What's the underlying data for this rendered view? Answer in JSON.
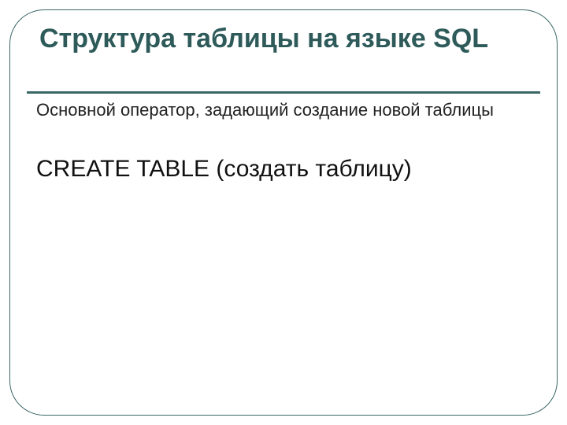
{
  "slide": {
    "title": "Структура таблицы на языке SQL",
    "subtitle": "Основной оператор, задающий создание новой таблицы",
    "command": "CREATE TABLE",
    "command_desc": " (создать таблицу)"
  }
}
